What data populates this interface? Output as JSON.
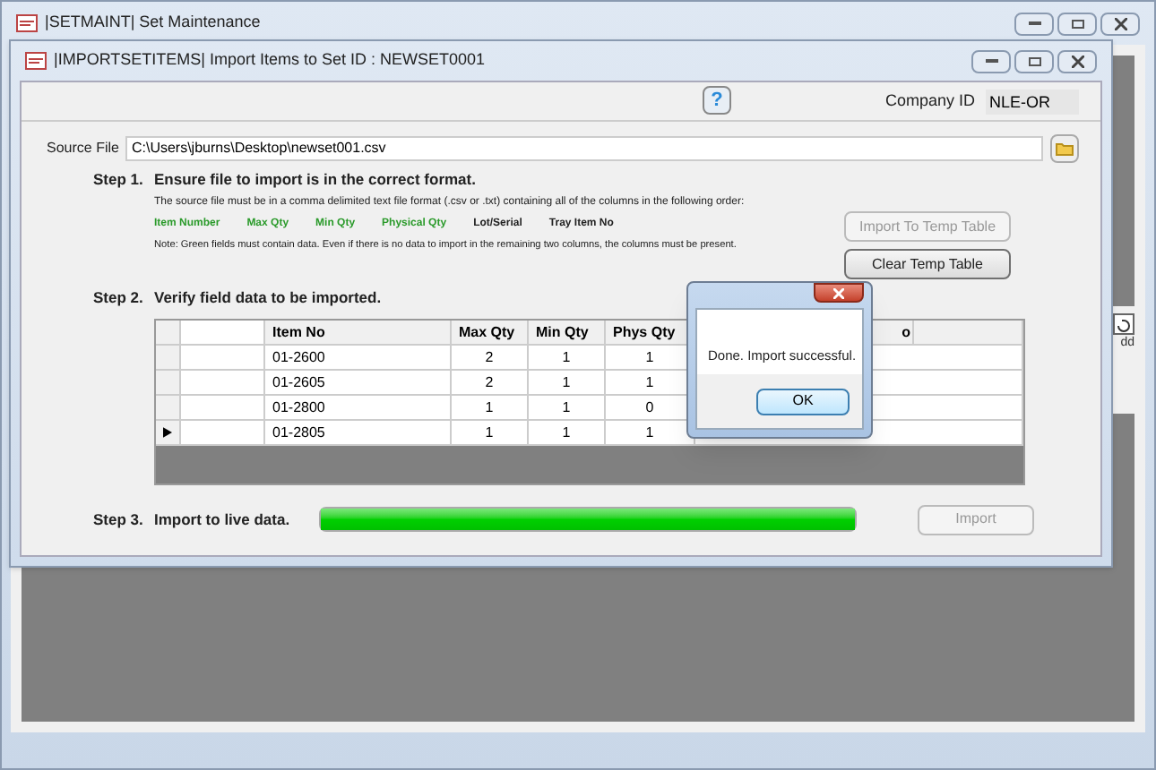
{
  "outer_window": {
    "title": "|SETMAINT| Set Maintenance",
    "side_label": "dd"
  },
  "import_window": {
    "title": "|IMPORTSETITEMS| Import Items to Set ID : NEWSET0001",
    "help_label": "?",
    "company_label": "Company ID",
    "company_value": "NLE-OR",
    "source_label": "Source File",
    "source_value": "C:\\Users\\jburns\\Desktop\\newset001.csv",
    "step1": {
      "number": "Step 1.",
      "title": "Ensure file to import is in the correct format.",
      "description": "The source file must be in a comma delimited text file format (.csv or .txt) containing all of the columns in the following order:",
      "fields": [
        {
          "label": "Item Number",
          "required": true
        },
        {
          "label": "Max Qty",
          "required": true
        },
        {
          "label": "Min Qty",
          "required": true
        },
        {
          "label": "Physical Qty",
          "required": true
        },
        {
          "label": "Lot/Serial",
          "required": false
        },
        {
          "label": "Tray Item No",
          "required": false
        }
      ],
      "note": "Note: Green fields must contain data.  Even if there is no data to import in the remaining two columns, the columns must be present."
    },
    "buttons": [
      {
        "label": "Import To Temp Table",
        "disabled": true
      },
      {
        "label": "Clear Temp Table",
        "disabled": false
      }
    ],
    "step2": {
      "number": "Step 2.",
      "title": "Verify field data to be imported."
    },
    "table": {
      "columns": [
        "Item No",
        "Max Qty",
        "Min Qty",
        "Phys Qty",
        "o"
      ],
      "rows": [
        {
          "item_no": "01-2600",
          "max_qty": "2",
          "min_qty": "1",
          "phys_qty": "1",
          "current": false
        },
        {
          "item_no": "01-2605",
          "max_qty": "2",
          "min_qty": "1",
          "phys_qty": "1",
          "current": false
        },
        {
          "item_no": "01-2800",
          "max_qty": "1",
          "min_qty": "1",
          "phys_qty": "0",
          "current": false
        },
        {
          "item_no": "01-2805",
          "max_qty": "1",
          "min_qty": "1",
          "phys_qty": "1",
          "current": true
        }
      ]
    },
    "step3": {
      "number": "Step 3.",
      "title": "Import to live data.",
      "level": 1
    },
    "import_button": {
      "label": "Import",
      "disabled": true
    }
  },
  "dialog": {
    "message": "Done. Import successful.",
    "ok": "OK"
  }
}
